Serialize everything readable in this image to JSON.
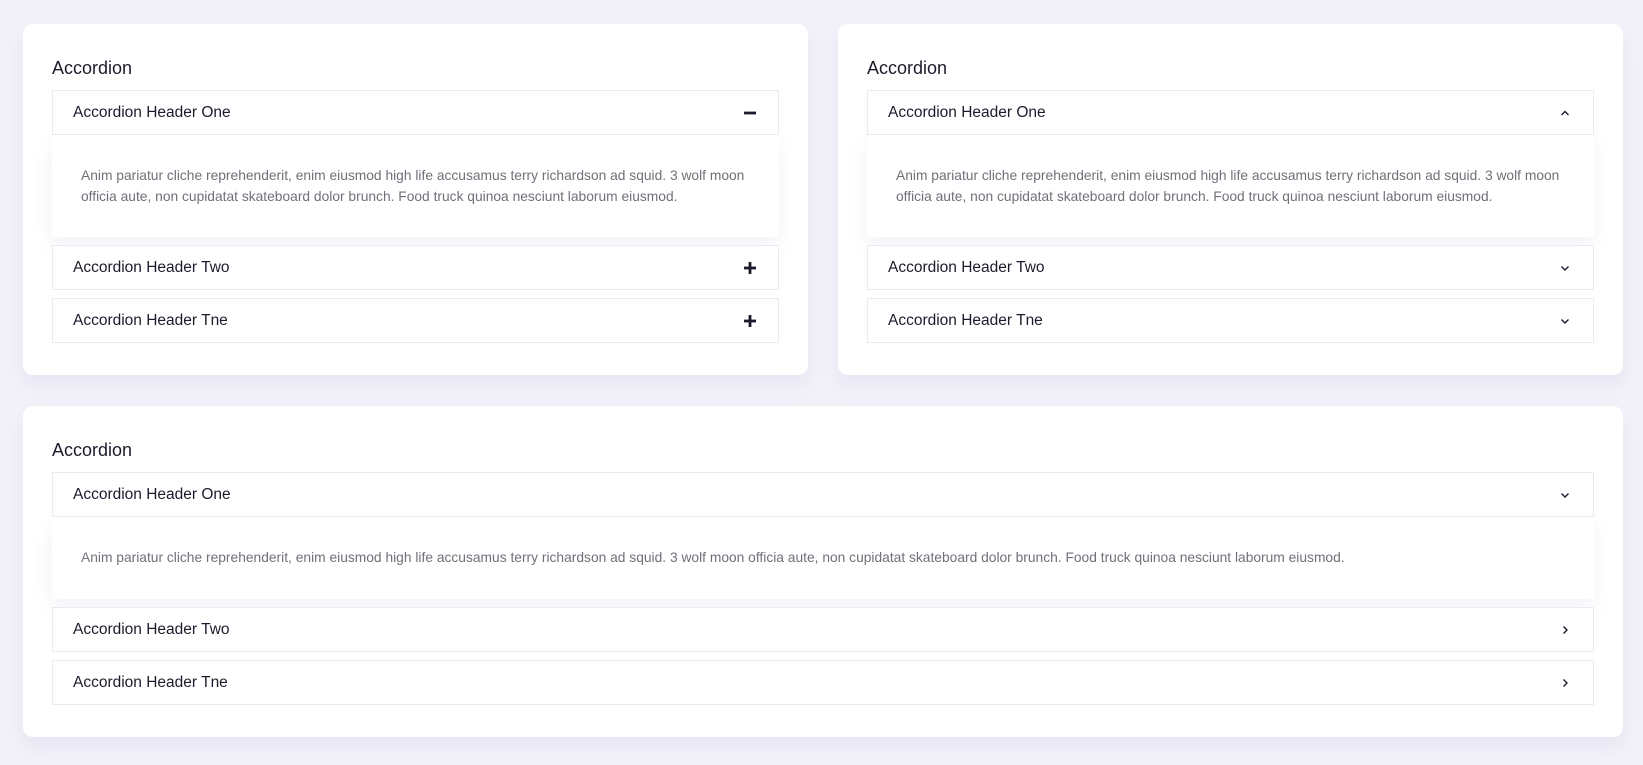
{
  "cards": [
    {
      "title": "Accordion",
      "items": [
        {
          "header": "Accordion Header One",
          "icon": "minus-icon",
          "open": true,
          "body": "Anim pariatur cliche reprehenderit, enim eiusmod high life accusamus terry richardson ad squid. 3 wolf moon officia aute, non cupidatat skateboard dolor brunch. Food truck quinoa nesciunt laborum eiusmod."
        },
        {
          "header": "Accordion Header Two",
          "icon": "plus-icon",
          "open": false
        },
        {
          "header": "Accordion Header Tne",
          "icon": "plus-icon",
          "open": false
        }
      ]
    },
    {
      "title": "Accordion",
      "items": [
        {
          "header": "Accordion Header One",
          "icon": "chevron-up-icon",
          "open": true,
          "body": "Anim pariatur cliche reprehenderit, enim eiusmod high life accusamus terry richardson ad squid. 3 wolf moon officia aute, non cupidatat skateboard dolor brunch. Food truck quinoa nesciunt laborum eiusmod."
        },
        {
          "header": "Accordion Header Two",
          "icon": "chevron-down-icon",
          "open": false
        },
        {
          "header": "Accordion Header Tne",
          "icon": "chevron-down-icon",
          "open": false
        }
      ]
    },
    {
      "title": "Accordion",
      "items": [
        {
          "header": "Accordion Header One",
          "icon": "chevron-down-icon",
          "open": true,
          "body": "Anim pariatur cliche reprehenderit, enim eiusmod high life accusamus terry richardson ad squid. 3 wolf moon officia aute, non cupidatat skateboard dolor brunch. Food truck quinoa nesciunt laborum eiusmod."
        },
        {
          "header": "Accordion Header Two",
          "icon": "chevron-right-icon",
          "open": false
        },
        {
          "header": "Accordion Header Tne",
          "icon": "chevron-right-icon",
          "open": false
        }
      ]
    }
  ],
  "colors": {
    "page_background": "#f3f2f9",
    "card_background": "#ffffff",
    "heading_text": "#1d1b2b",
    "body_text": "#70707a",
    "header_border": "#ebebef"
  }
}
